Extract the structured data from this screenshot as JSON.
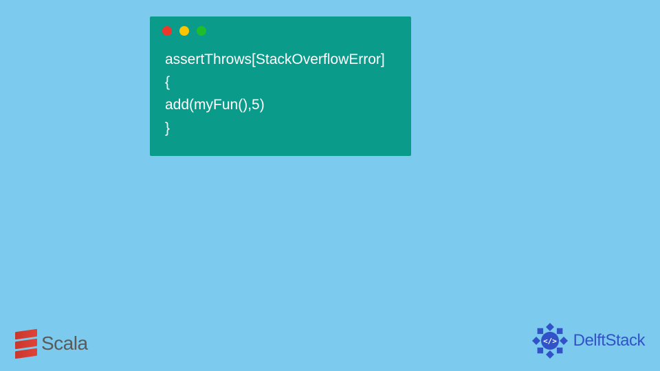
{
  "code": {
    "line1": "assertThrows[StackOverflowError]",
    "line2": "{",
    "line3": "add(myFun(),5)",
    "line4": "}"
  },
  "logos": {
    "scala": "Scala",
    "delftstack": "DelftStack"
  }
}
